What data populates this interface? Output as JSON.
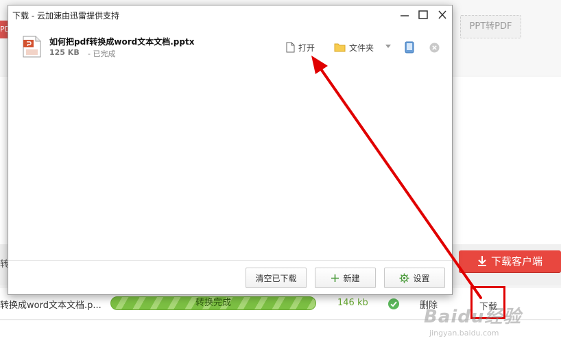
{
  "dialog": {
    "title": "下载 - 云加速由迅雷提供支持",
    "window_controls": {
      "minimize_icon": "minimize-icon",
      "maximize_icon": "maximize-icon",
      "close_icon": "close-icon"
    },
    "item": {
      "file_icon": "ppt-file-icon",
      "file_name": "如何把pdf转换成word文本文档.pptx",
      "size": "125 KB",
      "status": "- 已完成",
      "open_label": "打开",
      "folder_label": "文件夹"
    },
    "buttons": {
      "clear_label": "清空已下载",
      "new_label": "新建",
      "settings_label": "设置"
    }
  },
  "background": {
    "left_label": "PDF转",
    "ppt_to_pdf_label": "PPT转PDF",
    "strip_label": "转",
    "client_download_label": "下载客户端",
    "row": {
      "file_name": "转换成word文本文档.p...",
      "progress": 1.0,
      "progress_text": "转换完成",
      "size": "146 kb",
      "delete_label": "删除",
      "download_label": "下载"
    },
    "watermark": {
      "brand": "Baidu经验",
      "url": "jingyan.baidu.com"
    }
  },
  "colors": {
    "accent_red": "#e8473f",
    "progress_green": "#7cc043",
    "annotation_red": "#e00000"
  }
}
